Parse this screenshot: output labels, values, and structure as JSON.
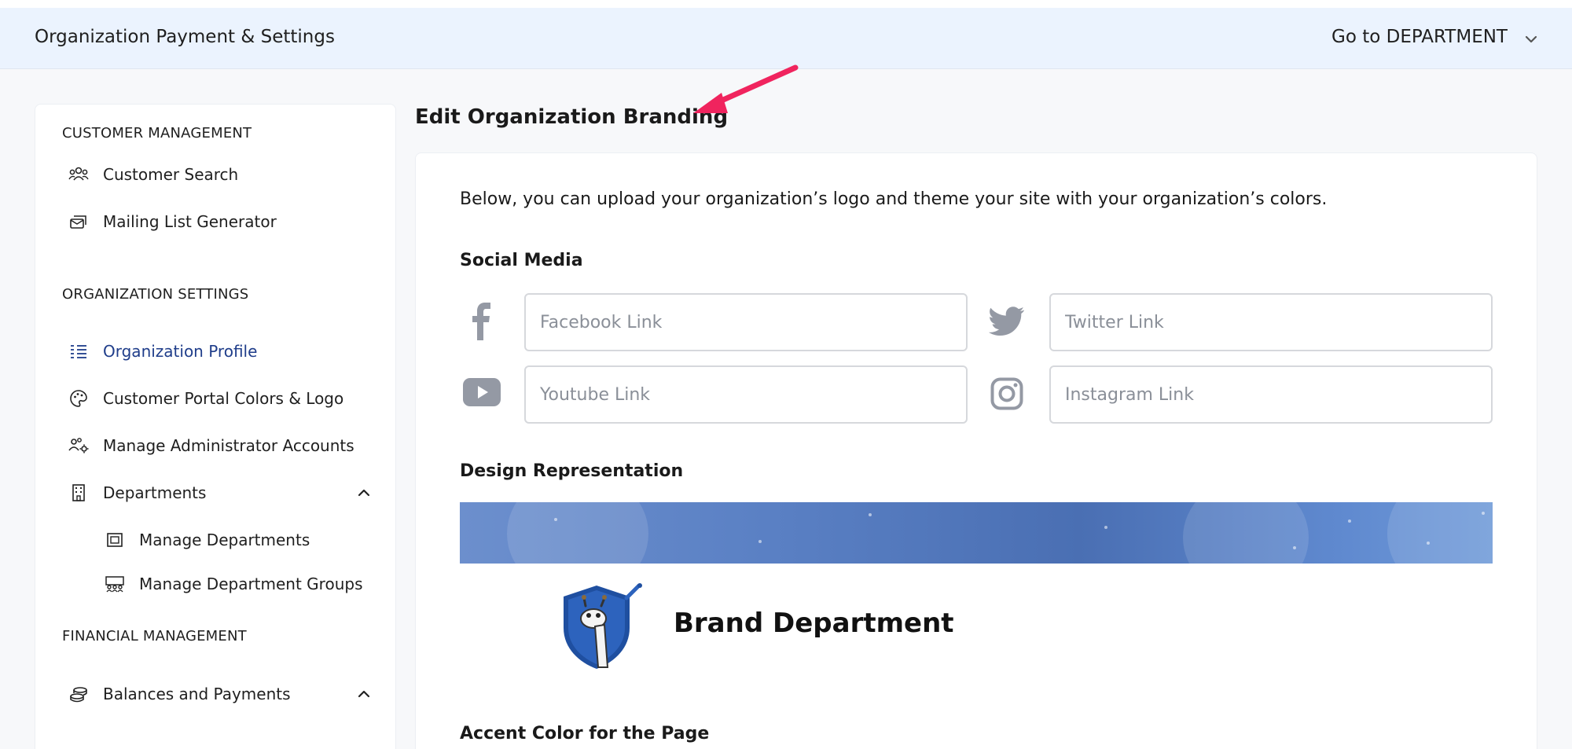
{
  "topbar": {
    "title": "Organization Payment & Settings",
    "goto_label": "Go to DEPARTMENT",
    "chevron_icon": "chevron-down-icon"
  },
  "sidebar": {
    "sections": [
      {
        "heading": "CUSTOMER MANAGEMENT",
        "items": [
          {
            "label": "Customer Search",
            "icon": "users-icon"
          },
          {
            "label": "Mailing List Generator",
            "icon": "mail-stack-icon"
          }
        ]
      },
      {
        "heading": "ORGANIZATION SETTINGS",
        "items": [
          {
            "label": "Organization Profile",
            "icon": "list-icon",
            "active": true
          },
          {
            "label": "Customer Portal Colors & Logo",
            "icon": "palette-icon"
          },
          {
            "label": "Manage Administrator Accounts",
            "icon": "users-gear-icon"
          },
          {
            "label": "Departments",
            "icon": "building-icon",
            "expanded": true,
            "children": [
              {
                "label": "Manage Departments",
                "icon": "frame-icon"
              },
              {
                "label": "Manage Department Groups",
                "icon": "group-icon"
              }
            ]
          }
        ]
      },
      {
        "heading": "FINANCIAL MANAGEMENT",
        "items": [
          {
            "label": "Balances and Payments",
            "icon": "coins-icon",
            "expanded": true
          }
        ]
      }
    ]
  },
  "main": {
    "heading": "Edit Organization Branding",
    "description": "Below, you can upload your organization’s logo and theme your site with your organization’s colors.",
    "social": {
      "heading": "Social Media",
      "facebook_placeholder": "Facebook Link",
      "twitter_placeholder": "Twitter Link",
      "youtube_placeholder": "Youtube Link",
      "instagram_placeholder": "Instagram Link"
    },
    "design": {
      "heading": "Design Representation",
      "department_name": "Brand Department"
    },
    "accent_heading": "Accent Color for the Page"
  },
  "colors": {
    "topbar_bg": "#ebf3fe",
    "active_nav": "#1f3d8a",
    "annotation_arrow": "#f0245e",
    "banner_blue": "#4a6fb3",
    "logo_shield": "#1f4fa0"
  }
}
